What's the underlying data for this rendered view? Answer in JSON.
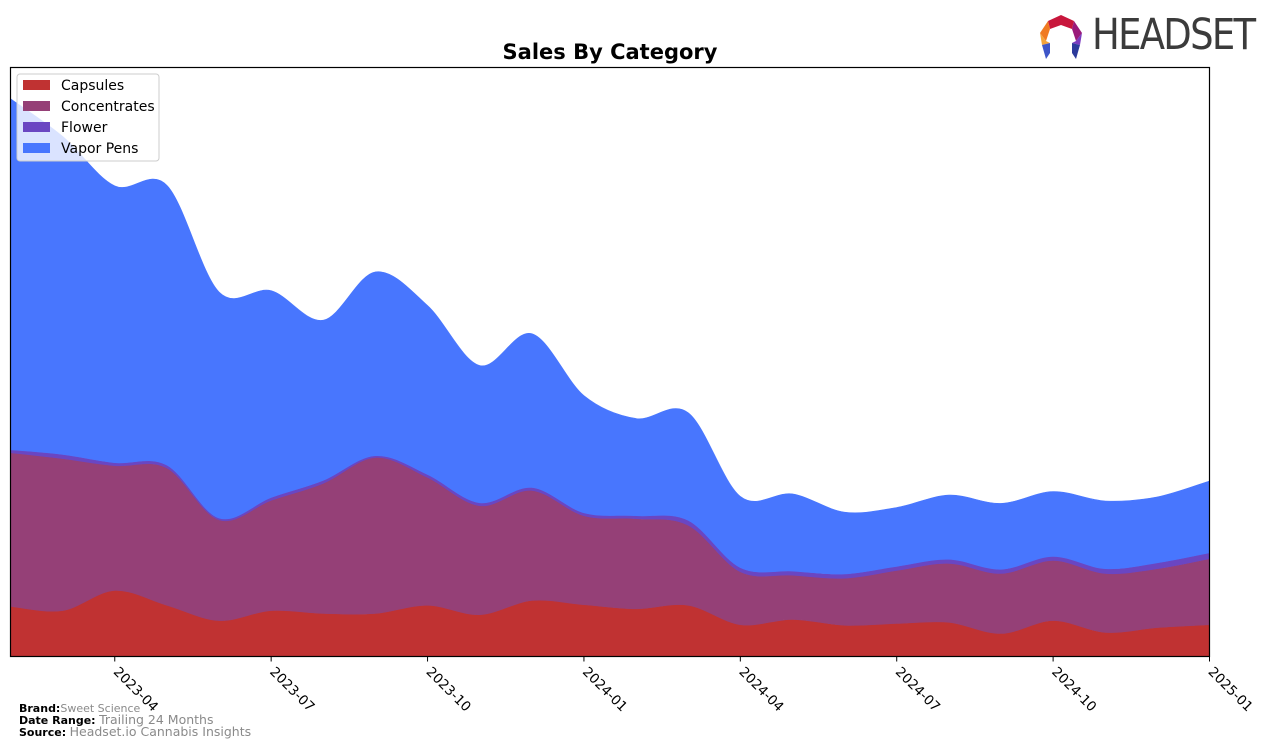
{
  "brand_logo": {
    "text": "HEADSET"
  },
  "footer": {
    "brand_label": "Brand:",
    "brand_value": "Sweet Science",
    "date_range_label": "Date Range:",
    "date_range_value": "Trailing 24 Months",
    "source_label": "Source:",
    "source_value": "Headset.io Cannabis Insights"
  },
  "colors": {
    "Capsules": "#c03232",
    "Concentrates": "#954077",
    "Flower": "#6a46c2",
    "Vapor Pens": "#4876fe"
  },
  "chart_data": {
    "type": "area",
    "stacked": true,
    "title": "Sales By Category",
    "xlabel": "",
    "ylabel": "",
    "y_units": "relative (plot height = 100, no y-axis shown)",
    "ylim": [
      0,
      100
    ],
    "grid": false,
    "legend_position": "top-left",
    "x": [
      "2023-02",
      "2023-03",
      "2023-04",
      "2023-05",
      "2023-06",
      "2023-07",
      "2023-08",
      "2023-09",
      "2023-10",
      "2023-11",
      "2023-12",
      "2024-01",
      "2024-02",
      "2024-03",
      "2024-04",
      "2024-05",
      "2024-06",
      "2024-07",
      "2024-08",
      "2024-09",
      "2024-10",
      "2024-11",
      "2024-12",
      "2025-01"
    ],
    "x_ticks": [
      "2023-04",
      "2023-07",
      "2023-10",
      "2024-01",
      "2024-04",
      "2024-07",
      "2024-10",
      "2025-01"
    ],
    "series": [
      {
        "name": "Capsules",
        "values": [
          8.5,
          7.8,
          11.2,
          8.7,
          6.1,
          7.8,
          7.3,
          7.3,
          8.7,
          7.1,
          9.5,
          8.8,
          8.1,
          8.7,
          5.4,
          6.3,
          5.3,
          5.6,
          5.8,
          3.9,
          6.1,
          4.1,
          4.9,
          5.4
        ]
      },
      {
        "name": "Concentrates",
        "values": [
          26.1,
          25.8,
          21.2,
          23.3,
          17.1,
          18.7,
          22.1,
          26.5,
          21.7,
          18.5,
          18.7,
          15.1,
          15.3,
          13.6,
          9.0,
          7.5,
          8.0,
          9.0,
          10.0,
          10.2,
          10.2,
          10.0,
          10.0,
          11.2
        ]
      },
      {
        "name": "Flower",
        "values": [
          0.5,
          0.7,
          0.5,
          0.5,
          0.3,
          0.5,
          0.5,
          0.3,
          0.5,
          0.5,
          0.5,
          0.5,
          0.5,
          0.8,
          0.7,
          0.7,
          0.7,
          0.7,
          0.7,
          0.7,
          0.7,
          0.8,
          1.0,
          1.0
        ]
      },
      {
        "name": "Vapor Pens",
        "values": [
          59.6,
          54.0,
          47.0,
          47.5,
          38.4,
          35.1,
          27.2,
          31.2,
          28.7,
          23.3,
          26.1,
          19.9,
          16.5,
          18.3,
          12.1,
          13.1,
          10.5,
          10.0,
          10.9,
          11.2,
          11.0,
          11.5,
          11.2,
          12.2
        ]
      }
    ]
  }
}
